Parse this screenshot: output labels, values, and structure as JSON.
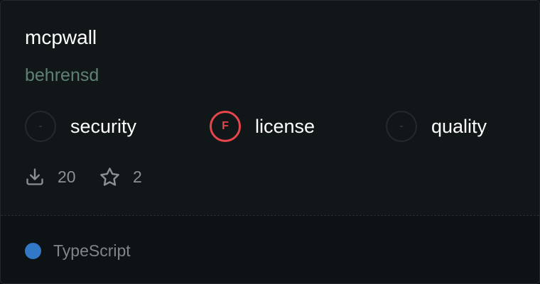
{
  "package": {
    "name": "mcpwall",
    "owner": "behrensd"
  },
  "scores": [
    {
      "grade": "-",
      "label": "security"
    },
    {
      "grade": "F",
      "label": "license"
    },
    {
      "grade": "-",
      "label": "quality"
    }
  ],
  "stats": {
    "downloads": "20",
    "stars": "2"
  },
  "language": {
    "name": "TypeScript",
    "color": "#3178c6"
  },
  "icons": {
    "downloads": "download-icon",
    "stars": "star-icon"
  }
}
